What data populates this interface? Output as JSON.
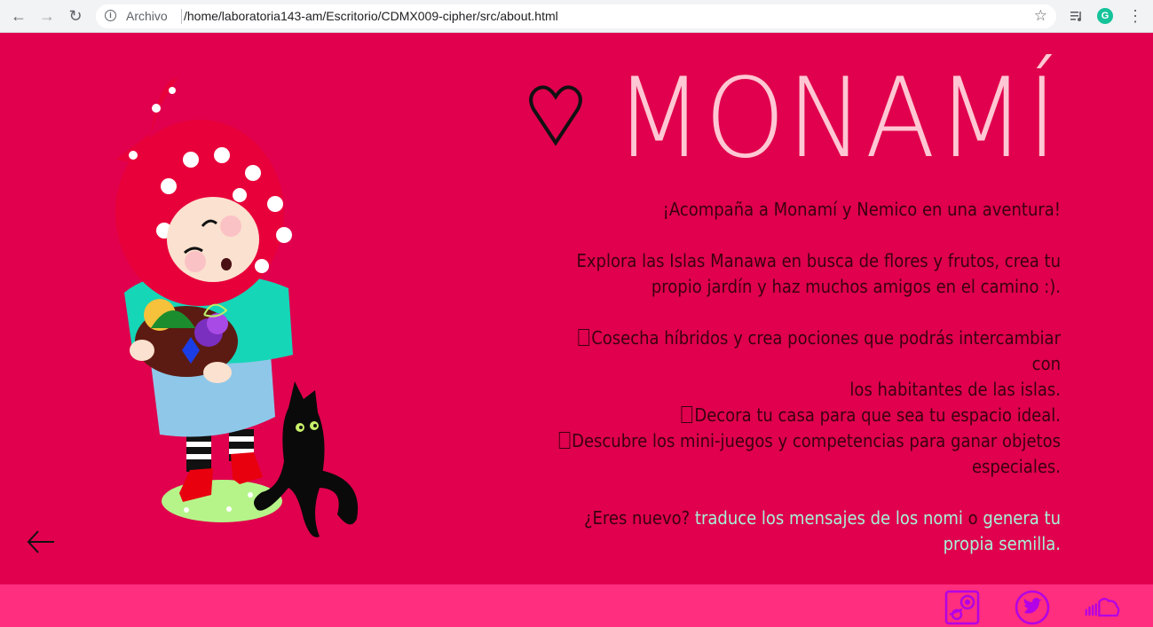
{
  "browser": {
    "scheme_label": "Archivo",
    "url": "/home/laboratoria143-am/Escritorio/CDMX009-cipher/src/about.html"
  },
  "page": {
    "title": "MONAMÍ",
    "intro": "¡Acompaña a Monamí y Nemico en una aventura!",
    "explore_line1": "Explora las Islas Manawa en busca de flores y frutos, crea tu",
    "explore_line2": "propio jardín y haz muchos amigos en el camino :).",
    "features": [
      {
        "line1": "Cosecha híbridos y crea pociones que podrás intercambiar con",
        "line2": "los habitantes de las islas."
      },
      {
        "line1": "Decora tu casa para que sea tu espacio ideal.",
        "line2": ""
      },
      {
        "line1": "Descubre los mini-juegos y competencias para ganar objetos",
        "line2": "especiales."
      }
    ],
    "cta_question": "¿Eres nuevo?",
    "cta_link1": "traduce los mensajes de los nomi",
    "cta_or": "o",
    "cta_link2_line1": "genera tu",
    "cta_link2_line2": "propia semilla."
  },
  "footer": {
    "social_icons": [
      "steam-icon",
      "twitter-icon",
      "soundcloud-icon"
    ]
  },
  "colors": {
    "background": "#e0004d",
    "footer": "#ff2e7e",
    "title": "#ffc7d3",
    "text": "#3a0010",
    "link": "#a8f0d8",
    "social_accent": "#b300e6"
  }
}
